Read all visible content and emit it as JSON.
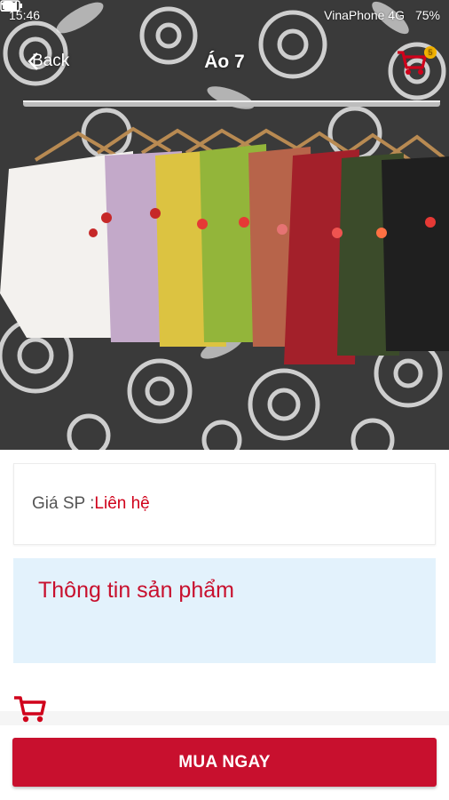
{
  "status_bar": {
    "time": "15:46",
    "carrier": "VinaPhone 4G",
    "battery": "75%"
  },
  "nav": {
    "back_label": "Back",
    "title": "Áo 7",
    "cart_count": "5"
  },
  "product": {
    "price_label": "Giá SP :",
    "price_value": "Liên hệ",
    "info_title": "Thông tin sản phẩm"
  },
  "actions": {
    "buy_now_label": "MUA NGAY"
  },
  "colors": {
    "accent_red": "#c8102e",
    "info_bg": "#e3f2fc",
    "badge": "#f4b400"
  }
}
